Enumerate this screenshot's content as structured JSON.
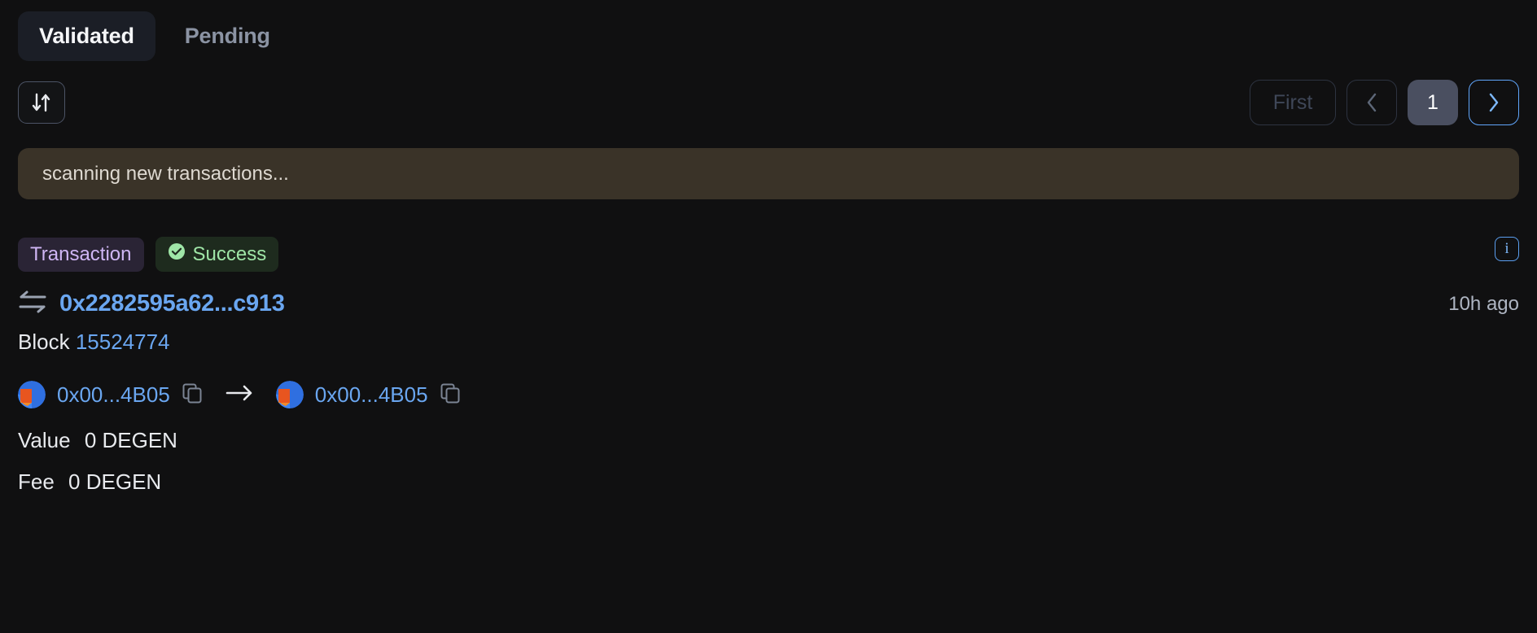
{
  "tabs": [
    {
      "label": "Validated",
      "active": true
    },
    {
      "label": "Pending",
      "active": false
    }
  ],
  "toolbar": {
    "sort_icon": "sort-arrows-icon"
  },
  "pagination": {
    "first_label": "First",
    "prev_icon": "chevron-left-icon",
    "current_page": "1",
    "next_icon": "chevron-right-icon"
  },
  "banner": {
    "text": "scanning new transactions...",
    "background": "#3a3328"
  },
  "transaction": {
    "type_badge": "Transaction",
    "status_badge": "Success",
    "status_icon": "check-circle-icon",
    "info_icon": "info-icon",
    "info_glyph": "i",
    "swap_icon": "swap-arrows-icon",
    "hash": "0x2282595a62...c913",
    "timestamp": "10h ago",
    "block_label": "Block",
    "block_number": "15524774",
    "from_address": "0x00...4B05",
    "to_address": "0x00...4B05",
    "copy_icon": "copy-icon",
    "direction_icon": "arrow-right-icon",
    "value_label": "Value",
    "value": "0 DEGEN",
    "fee_label": "Fee",
    "fee": "0 DEGEN"
  },
  "colors": {
    "page_background": "#101011",
    "accent_link": "#6aa6f0",
    "accent_focus": "#60a5fa",
    "badge_type_text": "#cfb6f5",
    "badge_status_text": "#9fe6a7",
    "current_page_fill": "#4a4f60"
  }
}
